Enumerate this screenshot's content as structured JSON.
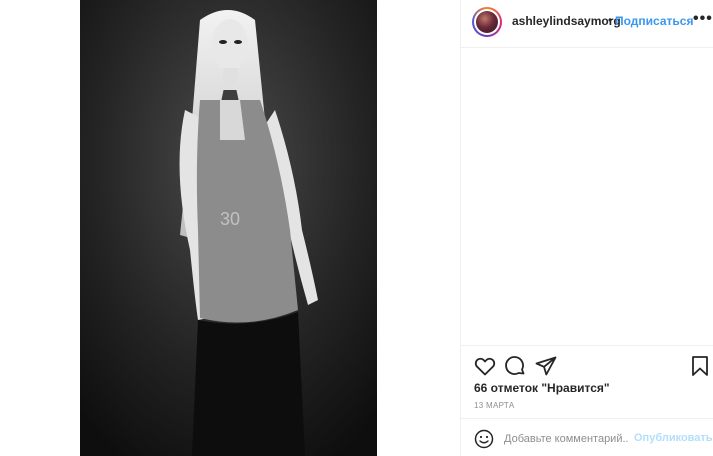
{
  "post": {
    "username": "ashleylindsaymorg",
    "dot": "•",
    "follow_label": "Подписаться",
    "more_label": "•••",
    "likes_text": "66 отметок \"Нравится\"",
    "date_text": "13 МАРТА",
    "comment_placeholder": "Добавьте комментарий...",
    "publish_label": "Опубликовать"
  },
  "icons": {
    "like": "heart-icon",
    "comment": "comment-icon",
    "share": "share-icon",
    "save": "bookmark-icon",
    "emoji": "emoji-icon",
    "more": "more-icon"
  },
  "colors": {
    "link_blue": "#3897f0",
    "publish_disabled": "#b2dffc",
    "muted_text": "#8e8e8e",
    "border": "#efefef"
  }
}
